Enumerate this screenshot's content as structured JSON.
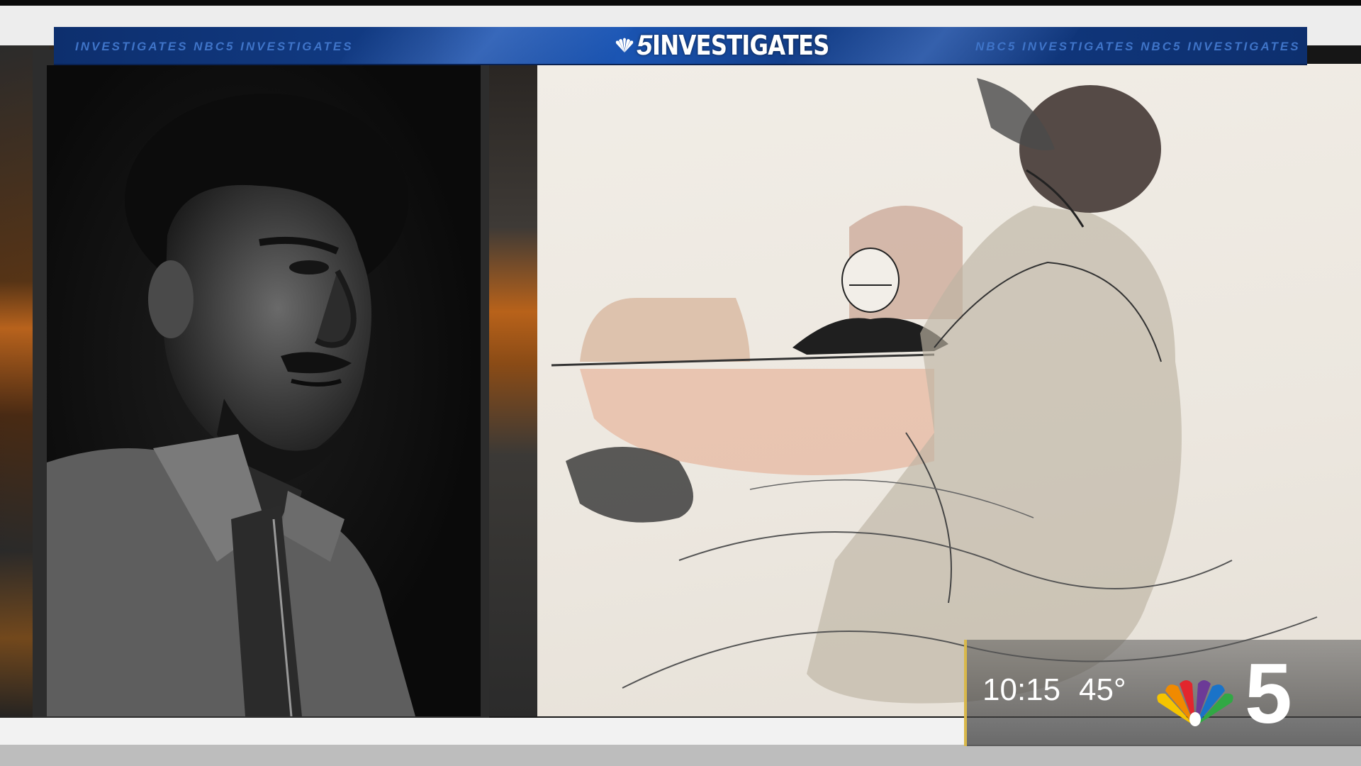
{
  "banner": {
    "logo_number": "5",
    "logo_word": "INVESTIGATES",
    "ticker_left": "INVESTIGATES  NBC5 INVESTIGATES",
    "ticker_right": "NBC5 INVESTIGATES  NBC5 INVESTIGATES"
  },
  "bug": {
    "time": "10:15",
    "temperature": "45°",
    "channel": "5"
  },
  "colors": {
    "banner_blue": "#123c86",
    "peacock": [
      "#f5c400",
      "#f08a00",
      "#e3262d",
      "#6c3a97",
      "#1a73c8",
      "#31a844"
    ]
  },
  "icons": {
    "station_logo": "nbc-peacock-icon"
  }
}
